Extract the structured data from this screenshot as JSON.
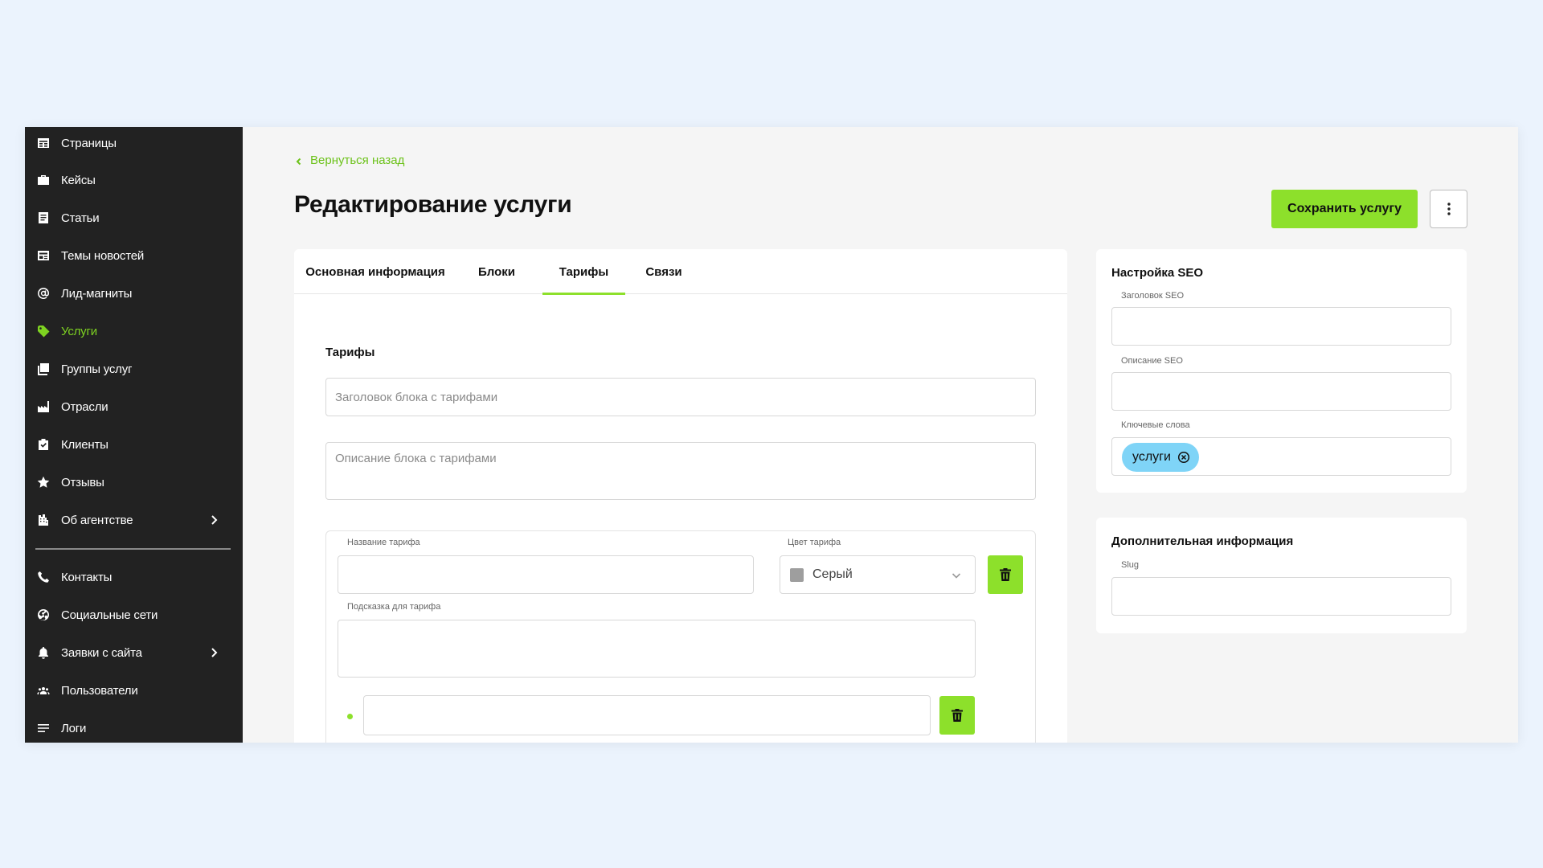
{
  "sidebar": {
    "items": [
      {
        "label": "Страницы",
        "icon": "pages-icon",
        "active": false,
        "has_children": false
      },
      {
        "label": "Кейсы",
        "icon": "briefcase-icon",
        "active": false,
        "has_children": false
      },
      {
        "label": "Статьи",
        "icon": "article-icon",
        "active": false,
        "has_children": false
      },
      {
        "label": "Темы новостей",
        "icon": "news-icon",
        "active": false,
        "has_children": false
      },
      {
        "label": "Лид-магниты",
        "icon": "magnet-icon",
        "active": false,
        "has_children": false
      },
      {
        "label": "Услуги",
        "icon": "tag-icon",
        "active": true,
        "has_children": false
      },
      {
        "label": "Группы услуг",
        "icon": "folder-icon",
        "active": false,
        "has_children": false
      },
      {
        "label": "Отрасли",
        "icon": "factory-icon",
        "active": false,
        "has_children": false
      },
      {
        "label": "Клиенты",
        "icon": "clipboard-icon",
        "active": false,
        "has_children": false
      },
      {
        "label": "Отзывы",
        "icon": "star-icon",
        "active": false,
        "has_children": false
      },
      {
        "label": "Об агентстве",
        "icon": "building-icon",
        "active": false,
        "has_children": true
      },
      {
        "label": "Контакты",
        "icon": "phone-icon",
        "active": false,
        "has_children": false
      },
      {
        "label": "Социальные сети",
        "icon": "globe-icon",
        "active": false,
        "has_children": false
      },
      {
        "label": "Заявки с сайта",
        "icon": "bell-icon",
        "active": false,
        "has_children": true
      },
      {
        "label": "Пользователи",
        "icon": "users-icon",
        "active": false,
        "has_children": false
      },
      {
        "label": "Логи",
        "icon": "lines-icon",
        "active": false,
        "has_children": false
      }
    ]
  },
  "header": {
    "back_label": "Вернуться назад",
    "title": "Редактирование услуги",
    "save_label": "Сохранить услугу"
  },
  "tabs": [
    {
      "label": "Основная информация",
      "active": false
    },
    {
      "label": "Блоки",
      "active": false
    },
    {
      "label": "Тарифы",
      "active": true
    },
    {
      "label": "Связи",
      "active": false
    }
  ],
  "tariffs": {
    "section_title": "Тарифы",
    "block_title_placeholder": "Заголовок блока с тарифами",
    "block_title_value": "",
    "block_description_placeholder": "Описание блока с тарифами",
    "block_description_value": "",
    "tariff": {
      "name_label": "Название тарифа",
      "name_value": "",
      "color_label": "Цвет тарифа",
      "color_value": "Серый",
      "color_swatch": "#9e9e9e",
      "hint_label": "Подсказка для тарифа",
      "hint_value": "",
      "feature_value": ""
    }
  },
  "seo": {
    "title": "Настройка SEO",
    "seo_title_label": "Заголовок SEO",
    "seo_title_value": "",
    "seo_description_label": "Описание SEO",
    "seo_description_value": "",
    "keywords_label": "Ключевые слова",
    "keywords": [
      "услуги"
    ]
  },
  "additional": {
    "title": "Дополнительная информация",
    "slug_label": "Slug",
    "slug_value": ""
  },
  "colors": {
    "accent": "#8de02b",
    "sidebar_bg": "#222222",
    "active_text": "#7ed321",
    "chip_bg": "#7fd4f7",
    "page_bg": "#ebf3fd"
  }
}
